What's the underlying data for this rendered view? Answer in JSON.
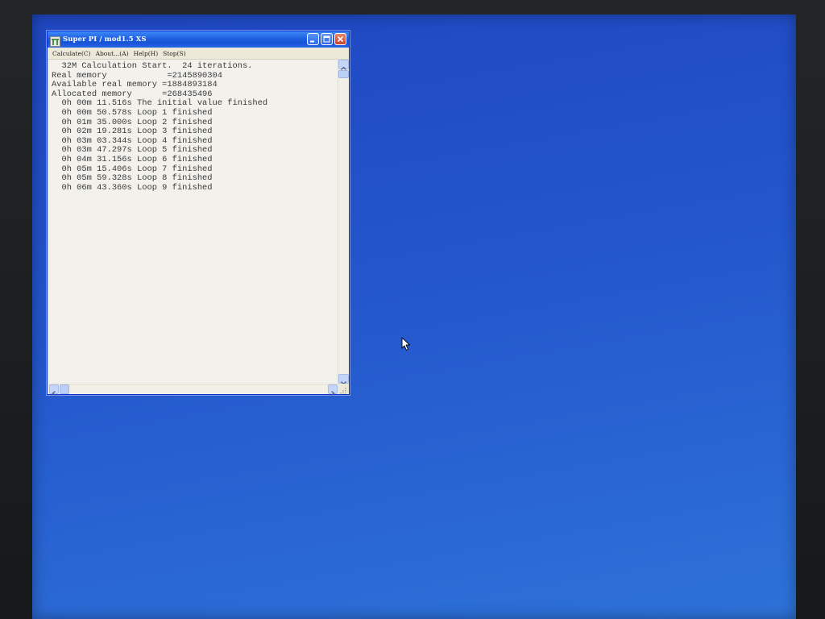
{
  "window": {
    "title": "Super PI / mod1.5 XS",
    "title_icon": "app-icon",
    "buttons": [
      "minimize-icon",
      "maximize-icon",
      "close-icon"
    ]
  },
  "menu": {
    "items": [
      {
        "label": "Calculate(C)"
      },
      {
        "label": "About...(A)"
      },
      {
        "label": "Help(H)"
      },
      {
        "label": "Stop(S)"
      }
    ]
  },
  "log": {
    "lines": [
      "  32M Calculation Start.  24 iterations.",
      "Real memory            =2145890304",
      "Available real memory =1884893184",
      "Allocated memory      =268435496",
      "  0h 00m 11.516s The initial value finished",
      "  0h 00m 50.578s Loop 1 finished",
      "  0h 01m 35.000s Loop 2 finished",
      "  0h 02m 19.281s Loop 3 finished",
      "  0h 03m 03.344s Loop 4 finished",
      "  0h 03m 47.297s Loop 5 finished",
      "  0h 04m 31.156s Loop 6 finished",
      "  0h 05m 15.406s Loop 7 finished",
      "  0h 05m 59.328s Loop 8 finished",
      "  0h 06m 43.360s Loop 9 finished"
    ]
  },
  "colors": {
    "desktop": "#2356cc",
    "titlebar": "#1e5fe0",
    "close_button": "#c9442a"
  }
}
